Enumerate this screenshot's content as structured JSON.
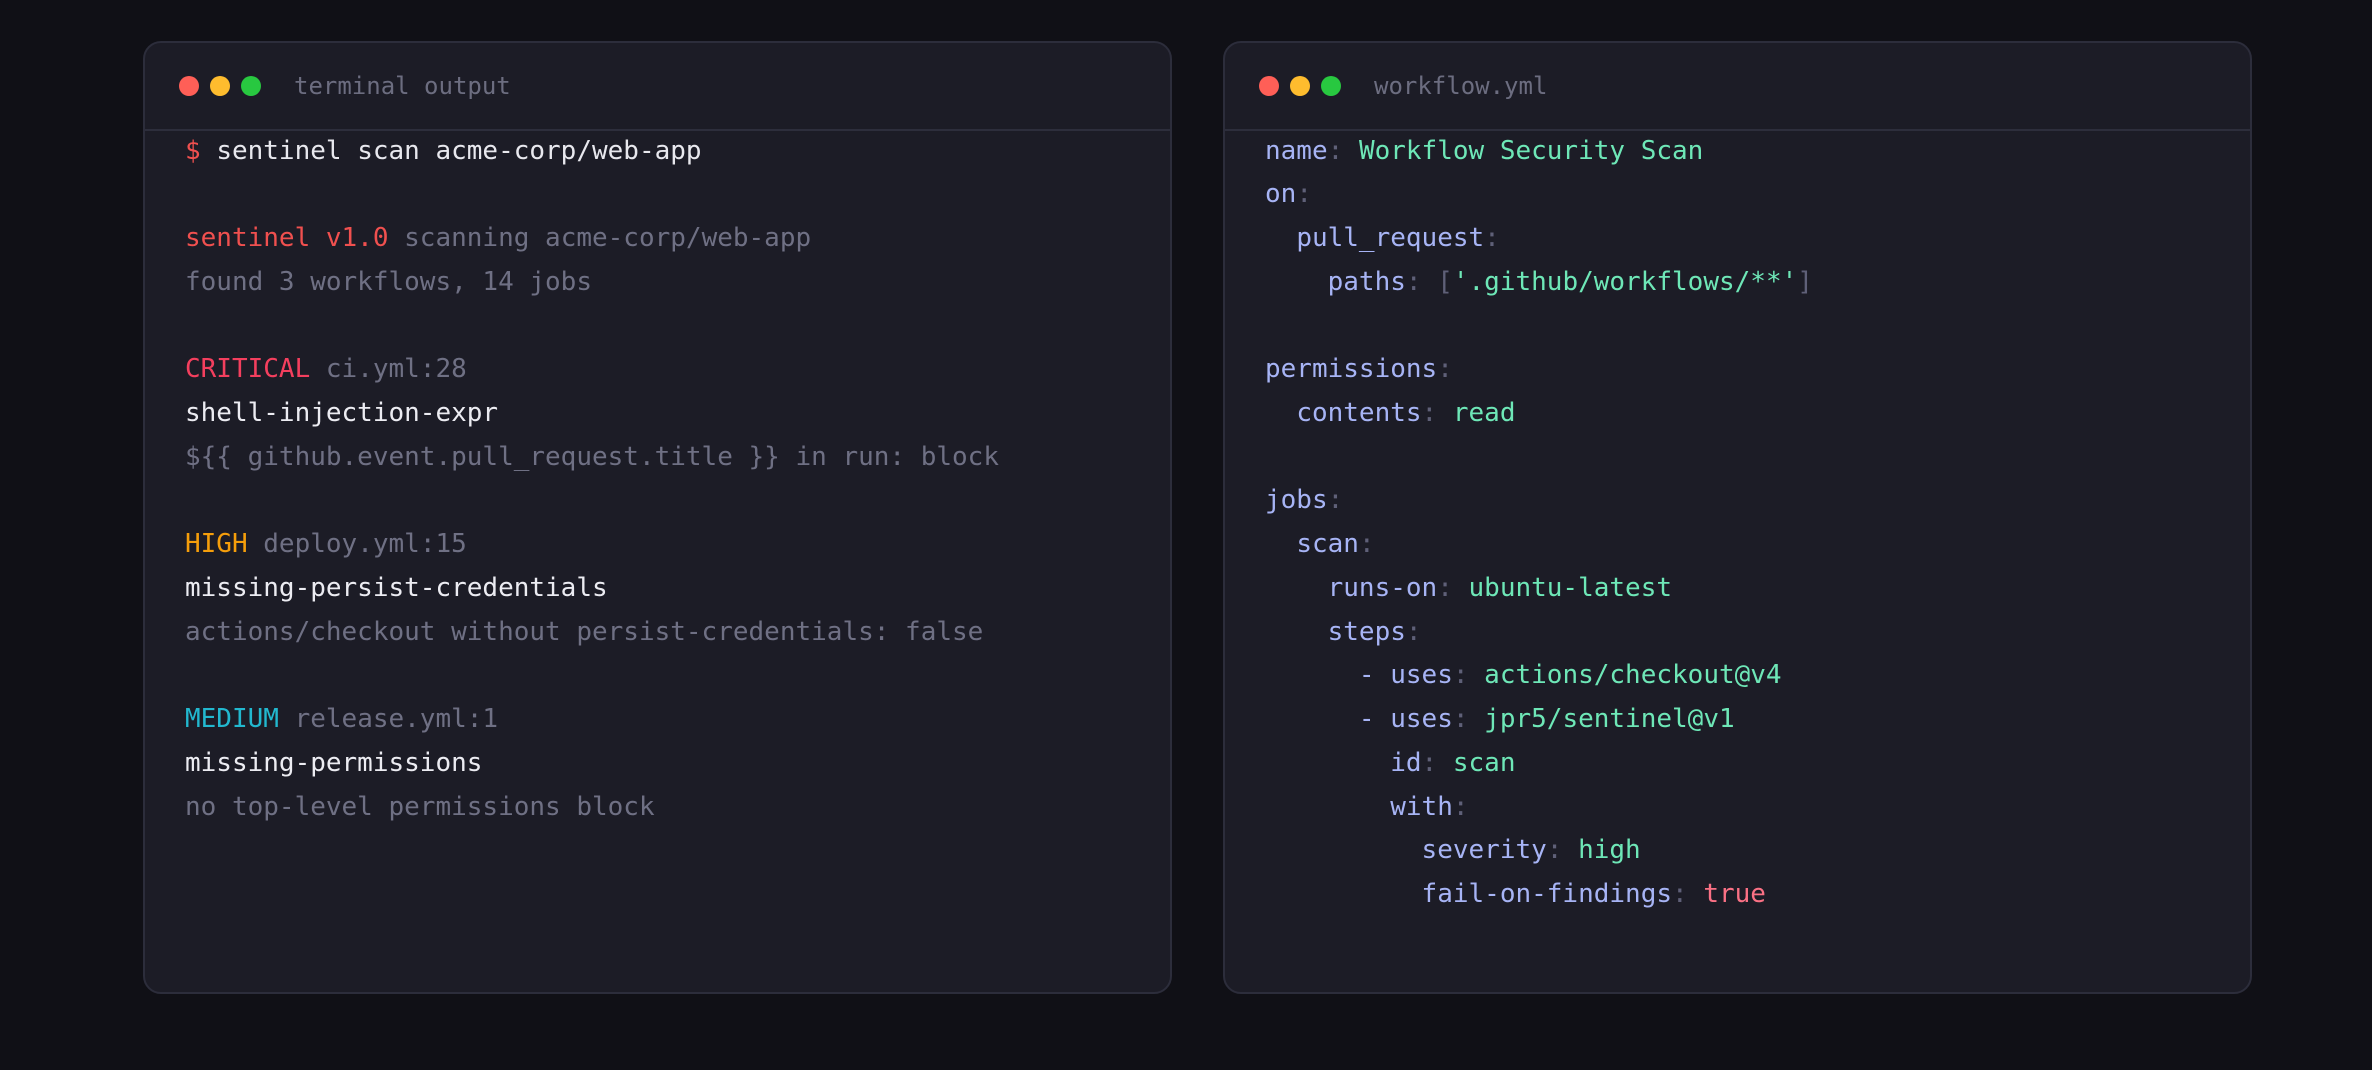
{
  "colors": {
    "background": "#101016",
    "window_bg": "#1c1c26",
    "prompt": "#f0504f",
    "critical": "#f43f5e",
    "high": "#f59e0b",
    "medium": "#22b8cf",
    "yaml_key": "#a7b4f5",
    "yaml_value": "#6ee7b7",
    "yaml_bool": "#fb7185"
  },
  "terminal": {
    "title": "terminal output",
    "prompt": "$",
    "command": "sentinel scan acme-corp/web-app",
    "banner_name": "sentinel v1.0",
    "banner_text": "scanning acme-corp/web-app",
    "summary": "found 3 workflows, 14 jobs",
    "findings": [
      {
        "severity": "CRITICAL",
        "location": "ci.yml:28",
        "rule": "shell-injection-expr",
        "detail": "${{ github.event.pull_request.title }} in run: block"
      },
      {
        "severity": "HIGH",
        "location": "deploy.yml:15",
        "rule": "missing-persist-credentials",
        "detail": "actions/checkout without persist-credentials: false"
      },
      {
        "severity": "MEDIUM",
        "location": "release.yml:1",
        "rule": "missing-permissions",
        "detail": "no top-level permissions block"
      }
    ]
  },
  "workflow": {
    "title": "workflow.yml",
    "lines": [
      {
        "key": "name",
        "value": "Workflow Security Scan"
      },
      {
        "key": "on",
        "value": ""
      },
      {
        "key": "pull_request",
        "value": ""
      },
      {
        "key": "paths",
        "value": "'.github/workflows/**'"
      },
      {
        "key": "permissions",
        "value": ""
      },
      {
        "key": "contents",
        "value": "read"
      },
      {
        "key": "jobs",
        "value": ""
      },
      {
        "key": "scan",
        "value": ""
      },
      {
        "key": "runs-on",
        "value": "ubuntu-latest"
      },
      {
        "key": "steps",
        "value": ""
      },
      {
        "key": "uses",
        "value": "actions/checkout@v4"
      },
      {
        "key": "uses",
        "value": "jpr5/sentinel@v1"
      },
      {
        "key": "id",
        "value": "scan"
      },
      {
        "key": "with",
        "value": ""
      },
      {
        "key": "severity",
        "value": "high"
      },
      {
        "key": "fail-on-findings",
        "value": "true"
      }
    ]
  }
}
